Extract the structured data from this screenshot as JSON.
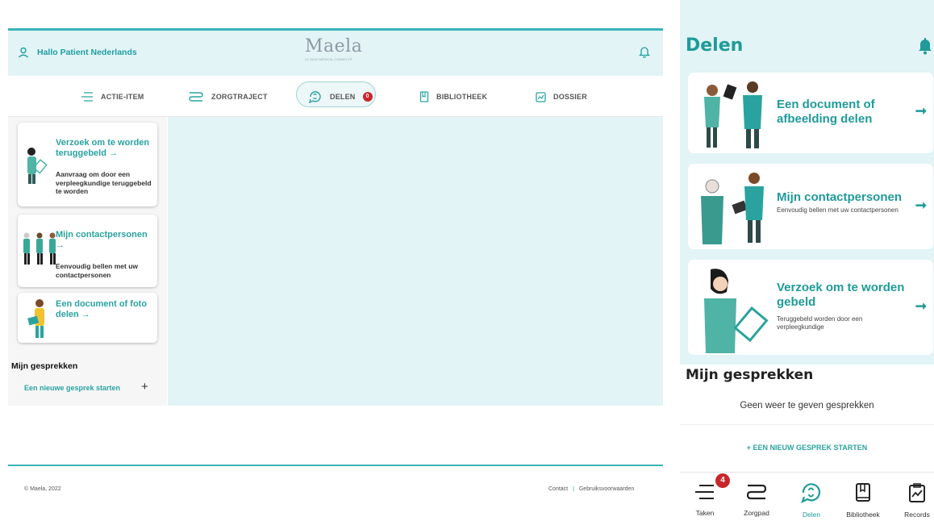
{
  "desktop": {
    "greeting": "Hallo Patient Nederlands",
    "logo": "Maela",
    "logo_sub": "LE SUIVI MÉDICAL CONNECTÉ",
    "nav": [
      {
        "label": "ACTIE-ITEM"
      },
      {
        "label": "ZORGTRAJECT"
      },
      {
        "label": "DELEN",
        "badge": "0"
      },
      {
        "label": "BIBLIOTHEEK"
      },
      {
        "label": "DOSSIER"
      }
    ],
    "cards": [
      {
        "title": "Verzoek om te worden teruggebeld →",
        "desc": "Aanvraag om door een verpleegkundige teruggebeld te worden"
      },
      {
        "title": "Mijn contactpersonen →",
        "desc": "Eenvoudig bellen met uw contactpersonen"
      },
      {
        "title": "Een document of foto delen →",
        "desc": ""
      }
    ],
    "conversations_title": "Mijn gesprekken",
    "new_conversation": "Een nieuwe gesprek starten",
    "plus": "+",
    "copyright": "© Maela, 2022",
    "footer_links": [
      "Contact",
      "Gebruiksvoorwaarden"
    ],
    "footer_sep": "|",
    "accent": "#2aa3a0"
  },
  "mobile": {
    "title": "Delen",
    "cards": [
      {
        "title": "Een document of afbeelding delen",
        "desc": ""
      },
      {
        "title": "Mijn contactpersonen",
        "desc": "Eenvoudig bellen met uw contactpersonen"
      },
      {
        "title": "Verzoek om te worden gebeld",
        "desc": "Teruggebeld worden door een verpleegkundige"
      }
    ],
    "arrow": "➞",
    "conversations_title": "Mijn gesprekken",
    "no_conversations": "Geen weer te geven gesprekken",
    "new_conversation": "+ EEN NIEUW GESPREK STARTEN",
    "tabs": [
      {
        "label": "Taken",
        "badge": "4"
      },
      {
        "label": "Zorgpad"
      },
      {
        "label": "Delen",
        "active": true
      },
      {
        "label": "Bibliotheek"
      },
      {
        "label": "Records"
      }
    ],
    "accent": "#1f9b9a",
    "badge_color": "#c9272c"
  }
}
